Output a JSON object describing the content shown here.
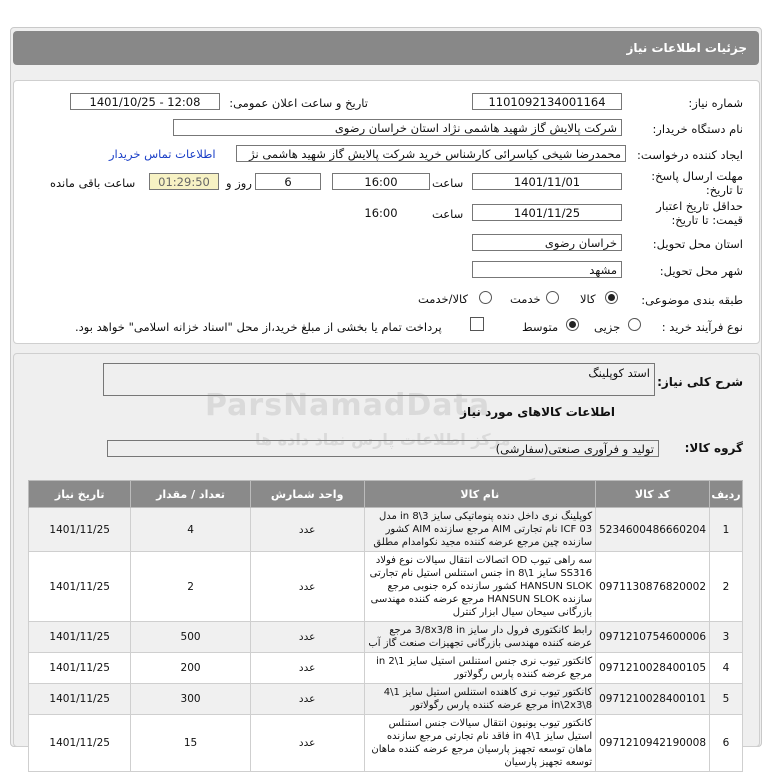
{
  "page_title": "جزئیات اطلاعات نیاز",
  "labels": {
    "need_number": "شماره نیاز:",
    "announce_datetime": "تاریخ و ساعت اعلان عمومی:",
    "buyer_name": "نام دستگاه خریدار:",
    "requester": "ایجاد کننده درخواست:",
    "contact_link": "اطلاعات تماس خریدار",
    "deadline": "مهلت ارسال پاسخ: تا تاریخ:",
    "time": "ساعت",
    "days_and": "روز و",
    "remaining": "ساعت باقی مانده",
    "validity": "حداقل تاریخ اعتبار قیمت: تا تاریخ:",
    "province": "استان محل تحویل:",
    "city": "شهر محل تحویل:",
    "category": "طبقه بندی موضوعی:",
    "process_type": "نوع فرآیند خرید :",
    "payment_note": "پرداخت تمام یا بخشی از مبلغ خرید،از محل \"اسناد خزانه اسلامی\" خواهد بود.",
    "general_desc": "شرح کلی نیاز:",
    "goods_info": "اطلاعات کالاهای مورد نیاز",
    "goods_group": "گروه کالا:"
  },
  "values": {
    "need_number": "1101092134001164",
    "announce_datetime": "1401/10/25 - 12:08",
    "buyer_name": "شرکت پالایش گاز شهید هاشمی نژاد   استان خراسان رضوی",
    "requester": "محمدرضا شیخی کیاسرائی کارشناس خرید شرکت پالایش گاز شهید هاشمی نژ",
    "deadline_date": "1401/11/01",
    "deadline_time": "16:00",
    "days": "6",
    "remaining_time": "01:29:50",
    "validity_date": "1401/11/25",
    "validity_time": "16:00",
    "province": "خراسان رضوی",
    "city": "مشهد",
    "general_desc": "استد کوپلینگ",
    "goods_group": "تولید و فرآوری صنعتی(سفارشی)"
  },
  "category_options": [
    {
      "label": "کالا",
      "selected": true
    },
    {
      "label": "خدمت",
      "selected": false
    },
    {
      "label": "کالا/خدمت",
      "selected": false
    }
  ],
  "process_options": [
    {
      "label": "جزیی",
      "selected": false
    },
    {
      "label": "متوسط",
      "selected": true
    }
  ],
  "watermark": {
    "logo": "ParsNamadData",
    "line1": "مرکز اطلاعات پارس نماد داده ها",
    "line2": "پایگاه اطلاع رسانی مناقصات و مزایده",
    "phone": "۰۲۱-۸۸۳۴۹۶۷۰"
  },
  "table": {
    "headers": [
      "ردیف",
      "کد کالا",
      "نام کالا",
      "واحد شمارش",
      "تعداد / مقدار",
      "تاریخ نیاز"
    ],
    "rows": [
      [
        "1",
        "5234600486660204",
        "کوپلینگ نری داخل دنده پنوماتیکی سایز 3\\8 in مدل ICF 03 نام تجارتی AIM مرجع سازنده AIM کشور سازنده چین مرجع عرضه کننده مجید نکوامدام مطلق",
        "عدد",
        "4",
        "1401/11/25"
      ],
      [
        "2",
        "0971130876820002",
        "سه راهی تیوب OD اتصالات انتقال سیالات نوع فولاد SS316 سایز 1\\8 in جنس استنلس استیل نام تجارتی HANSUN SLOK کشور سازنده کره جنوبی مرجع سازنده HANSUN SLOK مرجع عرضه کننده مهندسی بازرگانی سیحان سیال ابزار کنترل",
        "عدد",
        "2",
        "1401/11/25"
      ],
      [
        "3",
        "0971210754600006",
        "رابط کانکتوری فرول دار سایز 3/8x3/8 in مرجع عرضه کننده مهندسی بازرگانی تجهیزات صنعت گاز آب",
        "عدد",
        "500",
        "1401/11/25"
      ],
      [
        "4",
        "0971210028400105",
        "کانکتور تیوب نری جنس استنلس استیل سایز 1\\2 in مرجع عرضه کننده پارس رگولاتور",
        "عدد",
        "200",
        "1401/11/25"
      ],
      [
        "5",
        "0971210028400101",
        "کانکتور تیوب نری کاهنده استنلس استیل سایز 1\\4 in\\2x3\\8 مرجع عرضه کننده پارس رگولاتور",
        "عدد",
        "300",
        "1401/11/25"
      ],
      [
        "6",
        "0971210942190008",
        "کانکتور تیوب یونیون انتقال سیالات جنس استنلس استیل سایز 1\\4 in فاقد نام تجارتی مرجع سازنده ماهان توسعه تجهیز پارسیان مرجع عرضه کننده ماهان توسعه تجهیز پارسیان",
        "عدد",
        "15",
        "1401/11/25"
      ]
    ]
  }
}
